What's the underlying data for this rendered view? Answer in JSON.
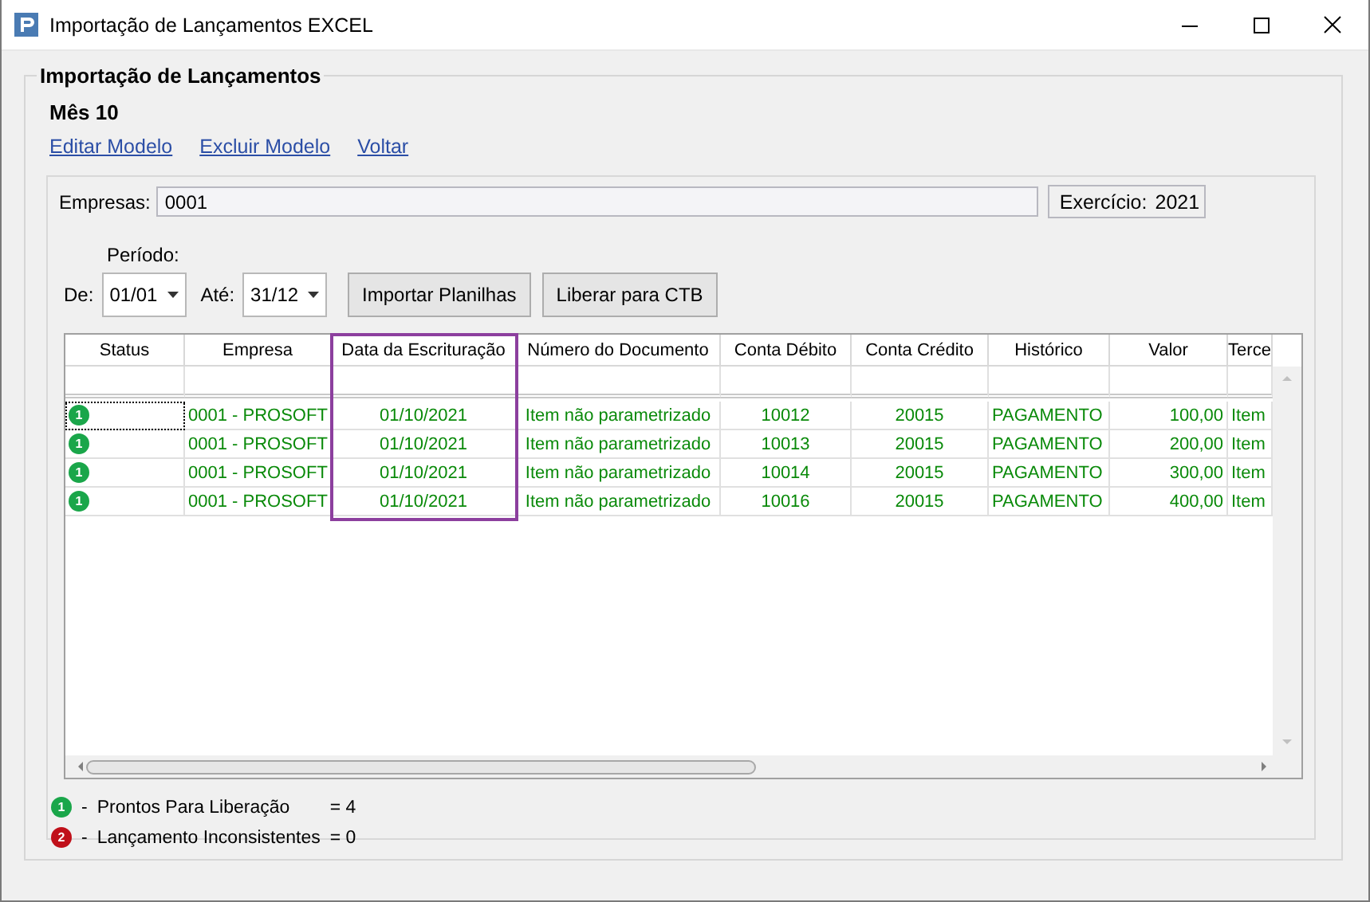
{
  "window": {
    "title": "Importação de Lançamentos EXCEL"
  },
  "group": {
    "title": "Importação de Lançamentos"
  },
  "month": "Mês 10",
  "links": [
    "Editar Modelo",
    "Excluir Modelo",
    "Voltar"
  ],
  "filters": {
    "empresas_label": "Empresas:",
    "empresas_value": "0001",
    "exercicio_label": "Exercício:",
    "exercicio_value": "2021",
    "periodo_label": "Período:",
    "de_label": "De:",
    "de_value": "01/01",
    "ate_label": "Até:",
    "ate_value": "31/12"
  },
  "buttons": [
    "Importar Planilhas",
    "Liberar para CTB"
  ],
  "table": {
    "columns": [
      {
        "label": "Status",
        "highlighted": false
      },
      {
        "label": "Empresa",
        "highlighted": false
      },
      {
        "label": "Data da Escrituração",
        "highlighted": true
      },
      {
        "label": "Número do Documento",
        "highlighted": false
      },
      {
        "label": "Conta Débito",
        "highlighted": false
      },
      {
        "label": "Conta Crédito",
        "highlighted": false
      },
      {
        "label": "Histórico",
        "highlighted": false
      },
      {
        "label": "Valor",
        "highlighted": false
      },
      {
        "label": "Terce",
        "highlighted": false
      }
    ],
    "rows": [
      {
        "focused": true,
        "color": "#1aa64a",
        "cells": [
          "1",
          "0001 - PROSOFT",
          "01/10/2021",
          "Item não parametrizado",
          "10012",
          "20015",
          "PAGAMENTO",
          "100,00",
          "Item"
        ]
      },
      {
        "focused": false,
        "color": "#1aa64a",
        "cells": [
          "1",
          "0001 - PROSOFT",
          "01/10/2021",
          "Item não parametrizado",
          "10013",
          "20015",
          "PAGAMENTO",
          "200,00",
          "Item"
        ]
      },
      {
        "focused": false,
        "color": "#1aa64a",
        "cells": [
          "1",
          "0001 - PROSOFT",
          "01/10/2021",
          "Item não parametrizado",
          "10014",
          "20015",
          "PAGAMENTO",
          "300,00",
          "Item"
        ]
      },
      {
        "focused": false,
        "color": "#1aa64a",
        "cells": [
          "1",
          "0001 - PROSOFT",
          "01/10/2021",
          "Item não parametrizado",
          "10016",
          "20015",
          "PAGAMENTO",
          "400,00",
          "Item"
        ]
      }
    ]
  },
  "legend": [
    {
      "badge": "1",
      "color": "#1aa64a",
      "dash": "-",
      "label": "Prontos Para Liberação",
      "count": "= 4"
    },
    {
      "badge": "2",
      "color": "#c0101a",
      "dash": "-",
      "label": "Lançamento Inconsistentes",
      "count": "= 0"
    }
  ]
}
